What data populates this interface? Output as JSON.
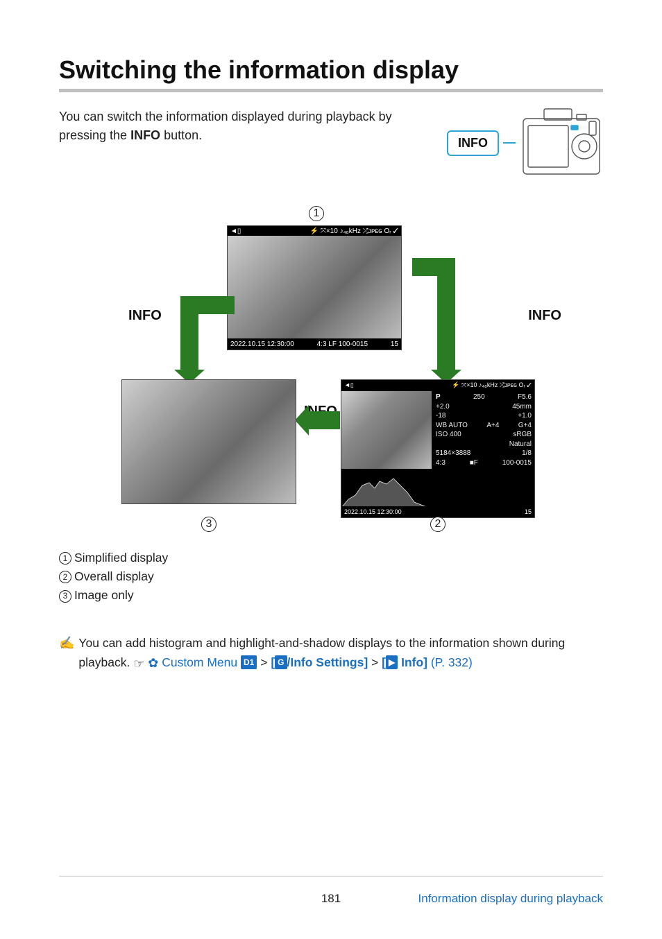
{
  "title": "Switching the information display",
  "intro": {
    "pre": "You can switch the information displayed during playback by pressing the ",
    "bold": "INFO",
    "post": " button."
  },
  "callout": {
    "label": "INFO"
  },
  "diagram": {
    "info_label": "INFO",
    "markers": {
      "m1": "1",
      "m2": "2",
      "m3": "3"
    },
    "shot_a": {
      "top_left": "◄▯",
      "top_right": "⚡ ⤧×10 ♪₄₈kHz ⤮ᴊᴘᴇɢ Oᵣ ✓",
      "bot_left": "2022.10.15 12:30:00",
      "mid_right": "  4:3  LF 100-0015",
      "bot_right": "15"
    },
    "shot_b": {
      "top_left": "◄▯",
      "top_right": "⚡ ⤧×10 ♪₄₈kHz ⤮ᴊᴘᴇɢ Oᵣ ✓",
      "bot_left": "2022.10.15   12:30:00",
      "bot_right": "15",
      "rows": [
        [
          "P",
          "250",
          "",
          "F5.6"
        ],
        [
          "",
          "+2.0",
          "",
          "45mm"
        ],
        [
          "",
          "-18",
          "",
          "+1.0"
        ],
        [
          "WB AUTO",
          "A+4",
          "",
          "G+4"
        ],
        [
          "ISO 400",
          "",
          "",
          "sRGB"
        ],
        [
          "",
          "",
          "",
          "Natural"
        ],
        [
          "5184×3888",
          "",
          "",
          "1/8"
        ],
        [
          "",
          "4:3",
          "■F",
          "100-0015"
        ]
      ]
    }
  },
  "legend": {
    "items": [
      {
        "num": "1",
        "text": "Simplified display"
      },
      {
        "num": "2",
        "text": "Overall display"
      },
      {
        "num": "3",
        "text": "Image only"
      }
    ]
  },
  "tip": {
    "text_a": "You can add histogram and highlight-and-shadow displays to the information shown during playback. ",
    "link1": "Custom Menu",
    "chip1": "D1",
    "sep1": ">",
    "bracket_open": "[",
    "chip2": "G",
    "link2": "/Info Settings]",
    "sep2": ">",
    "bracket_open2": "[",
    "chip3": "▶",
    "link3": " Info]",
    "ref": " (P. 332)"
  },
  "footer": {
    "page": "181",
    "crumb": "Information display during playback"
  }
}
